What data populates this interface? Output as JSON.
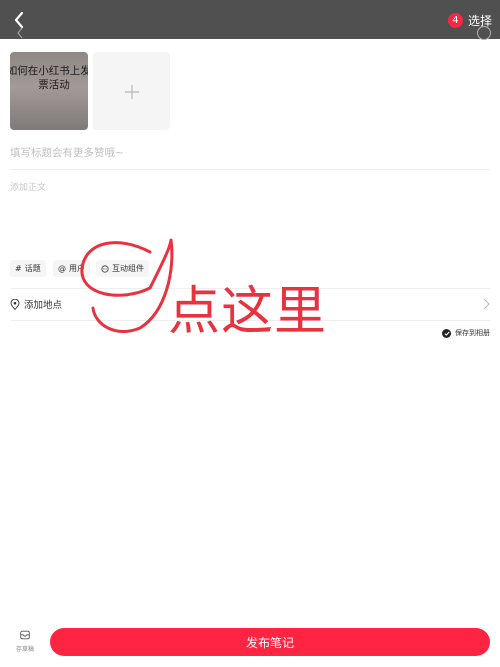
{
  "topbar": {
    "selected_count": "4",
    "select_label": "选择"
  },
  "media": {
    "thumbnail_text": "如何在小红书上发起\n票活动",
    "add_label": "+"
  },
  "editor": {
    "title_placeholder": "填写标题会有更多赞哦~",
    "body_placeholder": "添加正文"
  },
  "chips": [
    {
      "icon": "hashtag-icon",
      "glyph": "#",
      "label": "话题"
    },
    {
      "icon": "at-icon",
      "glyph": "@",
      "label": "用户"
    },
    {
      "icon": "chat-bubble-icon",
      "glyph": "",
      "label": "互动组件"
    }
  ],
  "location": {
    "label": "添加地点"
  },
  "save_to_album": {
    "label": "保存到相册"
  },
  "annotation": {
    "text": "点这里",
    "color": "#e8323f"
  },
  "bottom": {
    "draft_label": "存草稿",
    "publish_label": "发布笔记"
  },
  "colors": {
    "brand": "#ff2442",
    "topbar": "#505050",
    "annotation": "#e8323f"
  }
}
